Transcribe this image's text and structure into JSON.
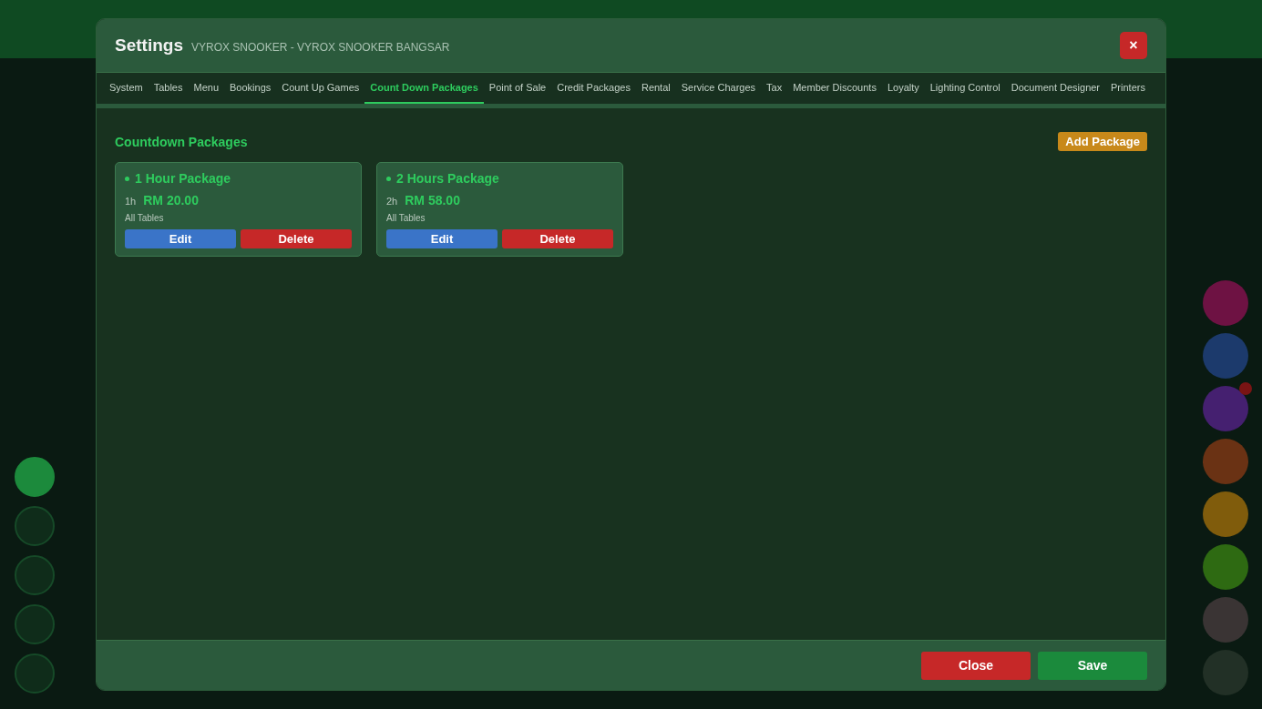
{
  "background": {
    "left_buttons": [
      {
        "selected": true
      },
      {
        "selected": false
      },
      {
        "selected": false
      },
      {
        "selected": false
      },
      {
        "selected": false
      }
    ],
    "right_buttons": [
      {
        "color": "#6e1243"
      },
      {
        "color": "#1c3a6c"
      },
      {
        "color": "#452070",
        "badge": true
      },
      {
        "color": "#6a3214"
      },
      {
        "color": "#805c0c"
      },
      {
        "color": "#2e6a12"
      },
      {
        "color": "#3a3434"
      },
      {
        "color": "#223026"
      }
    ]
  },
  "dialog": {
    "title": "Settings",
    "subtitle": "VYROX SNOOKER - VYROX SNOOKER BANGSAR",
    "close_icon": "×"
  },
  "tabs": [
    {
      "label": "System",
      "selected": false
    },
    {
      "label": "Tables",
      "selected": false
    },
    {
      "label": "Menu",
      "selected": false
    },
    {
      "label": "Bookings",
      "selected": false
    },
    {
      "label": "Count Up Games",
      "selected": false
    },
    {
      "label": "Count Down Packages",
      "selected": true
    },
    {
      "label": "Point of Sale",
      "selected": false
    },
    {
      "label": "Credit Packages",
      "selected": false
    },
    {
      "label": "Rental",
      "selected": false
    },
    {
      "label": "Service Charges",
      "selected": false
    },
    {
      "label": "Tax",
      "selected": false
    },
    {
      "label": "Member Discounts",
      "selected": false
    },
    {
      "label": "Loyalty",
      "selected": false
    },
    {
      "label": "Lighting Control",
      "selected": false
    },
    {
      "label": "Document Designer",
      "selected": false
    },
    {
      "label": "Printers",
      "selected": false
    }
  ],
  "section": {
    "title": "Countdown Packages",
    "add_button": "Add Package"
  },
  "packages": [
    {
      "name": "1 Hour Package",
      "duration": "1h",
      "price": "RM 20.00",
      "scope": "All Tables",
      "edit": "Edit",
      "delete": "Delete"
    },
    {
      "name": "2 Hours Package",
      "duration": "2h",
      "price": "RM 58.00",
      "scope": "All Tables",
      "edit": "Edit",
      "delete": "Delete"
    }
  ],
  "footer": {
    "close": "Close",
    "save": "Save"
  }
}
